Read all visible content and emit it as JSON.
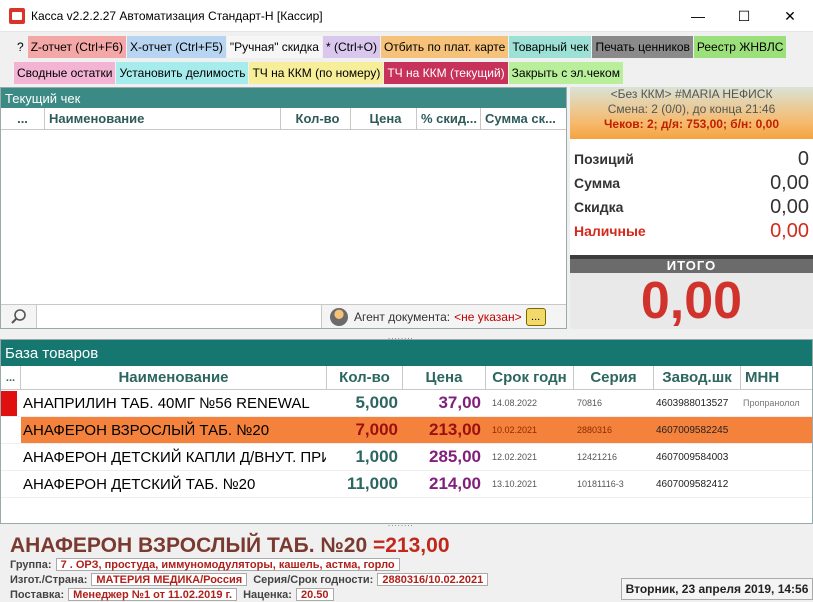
{
  "window": {
    "title": "Касса v2.2.2.27 Автоматизация Стандарт-Н [Кассир]"
  },
  "toolbar": {
    "row1": [
      {
        "label": "?",
        "bg": "#f0f0f0"
      },
      {
        "label": "Z-отчет (Ctrl+F6)",
        "bg": "#f4a7a7"
      },
      {
        "label": "X-отчет (Ctrl+F5)",
        "bg": "#b7d4f0"
      },
      {
        "label": "\"Ручная\" скидка",
        "bg": "#f6f6f6"
      },
      {
        "label": "* (Ctrl+O)",
        "bg": "#d9c7ee"
      },
      {
        "label": "Отбить по плат. карте",
        "bg": "#f6c27a"
      },
      {
        "label": "Товарный чек",
        "bg": "#9de0d6"
      },
      {
        "label": "Печать ценников",
        "bg": "#8a8a8a"
      },
      {
        "label": "Реестр ЖНВЛС",
        "bg": "#9be07a"
      }
    ],
    "row2": [
      {
        "label": "Сводные остатки",
        "bg": "#f3b3d3"
      },
      {
        "label": "Установить делимость",
        "bg": "#a6ecec"
      },
      {
        "label": "ТЧ на ККМ (по номеру)",
        "bg": "#f7ee9a"
      },
      {
        "label": "ТЧ на ККМ (текущий)",
        "bg": "#c7325a"
      },
      {
        "label": "Закрыть с эл.чеком",
        "bg": "#b9ef9a"
      }
    ]
  },
  "receipt": {
    "title": "Текущий чек",
    "columns": [
      "...",
      "Наименование",
      "Кол-во",
      "Цена",
      "% скид...",
      "Сумма ск..."
    ],
    "agent_label": "Агент документа:",
    "agent_value": "<не указан>",
    "ellipsis": "..."
  },
  "summary": {
    "line1": "<Без ККМ> #MARIA НЕФИСК",
    "line2": "Смена: 2 (0/0), до конца 21:46",
    "line3": "Чеков: 2; д/я: 753,00; б/н: 0,00",
    "rows": [
      {
        "label": "Позиций",
        "value": "0"
      },
      {
        "label": "Сумма",
        "value": "0,00"
      },
      {
        "label": "Скидка",
        "value": "0,00"
      },
      {
        "label": "Наличные",
        "value": "0,00"
      }
    ],
    "total_label": "ИТОГО",
    "total_value": "0,00"
  },
  "products": {
    "title": "База товаров",
    "columns": [
      "...",
      "Наименование",
      "Кол-во",
      "Цена",
      "Срок годн",
      "Серия",
      "Завод.шк",
      "МНН"
    ],
    "rows": [
      {
        "name": "АНАПРИЛИН ТАБ. 40МГ №56 RENEWAL",
        "qty": "5,000",
        "price": "37,00",
        "exp": "14.08.2022",
        "series": "70816",
        "barcode": "4603988013527",
        "mnn": "Пропранолол"
      },
      {
        "name": "АНАФЕРОН ВЗРОСЛЫЙ ТАБ. №20",
        "qty": "7,000",
        "price": "213,00",
        "exp": "10.02.2021",
        "series": "2880316",
        "barcode": "4607009582245",
        "mnn": ""
      },
      {
        "name": "АНАФЕРОН ДЕТСКИЙ КАПЛИ Д/ВНУТ. ПРИЕ",
        "qty": "1,000",
        "price": "285,00",
        "exp": "12.02.2021",
        "series": "12421216",
        "barcode": "4607009584003",
        "mnn": ""
      },
      {
        "name": "АНАФЕРОН ДЕТСКИЙ ТАБ. №20",
        "qty": "11,000",
        "price": "214,00",
        "exp": "13.10.2021",
        "series": "10181116-3",
        "barcode": "4607009582412",
        "mnn": ""
      }
    ]
  },
  "detail": {
    "name": "АНАФЕРОН ВЗРОСЛЫЙ ТАБ. №20",
    "price": "=213,00",
    "group_label": "Группа:",
    "group_value": "7 . ОРЗ, простуда, иммуномодуляторы, кашель, астма, горло",
    "manufacturer_label": "Изгот./Страна:",
    "manufacturer_value": "МАТЕРИЯ МЕДИКА/Россия",
    "series_label": "Серия/Срок годности:",
    "series_value": "2880316/10.02.2021",
    "supply_label": "Поставка:",
    "supply_value": "Менеджер №1 от 11.02.2019 г.",
    "markup_label": "Наценка:",
    "markup_value": "20.50",
    "datetime": "Вторник, 23 апреля 2019, 14:56"
  }
}
